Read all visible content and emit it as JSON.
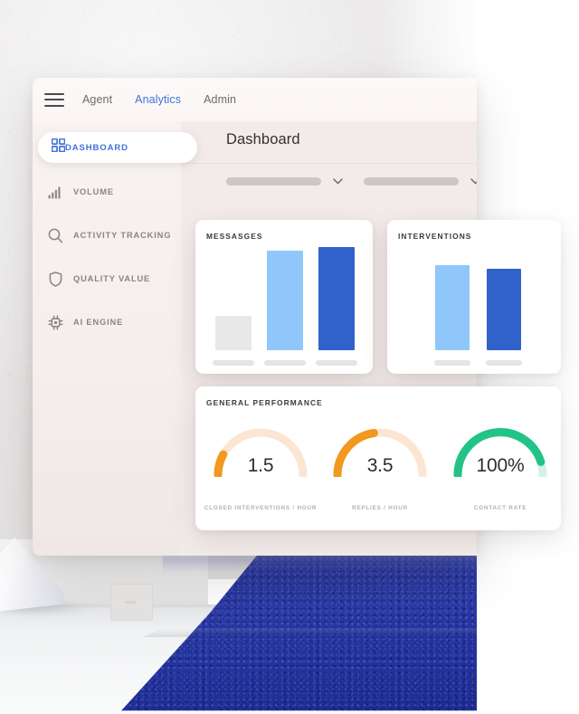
{
  "app": {
    "topbar": {
      "menu_icon": "hamburger-icon",
      "nav": [
        {
          "label": "Agent",
          "active": false
        },
        {
          "label": "Analytics",
          "active": true
        },
        {
          "label": "Admin",
          "active": false
        }
      ]
    },
    "sidebar": {
      "items": [
        {
          "label": "DASHBOARD",
          "icon": "grid-icon",
          "active": true
        },
        {
          "label": "VOLUME",
          "icon": "bar-chart-icon",
          "active": false
        },
        {
          "label": "ACTIVITY TRACKING",
          "icon": "search-icon",
          "active": false
        },
        {
          "label": "QUALITY VALUE",
          "icon": "shield-icon",
          "active": false
        },
        {
          "label": "AI ENGINE",
          "icon": "chip-icon",
          "active": false
        }
      ]
    },
    "main": {
      "page_title": "Dashboard",
      "filters": [
        {
          "name": "filter-one",
          "value": "",
          "icon": "chevron-down-icon"
        },
        {
          "name": "filter-two",
          "value": "",
          "icon": "chevron-down-icon"
        }
      ]
    }
  },
  "cards": {
    "messages": {
      "title": "MESSASGES"
    },
    "interventions": {
      "title": "INTERVENTIONS"
    },
    "performance": {
      "title": "GENERAL PERFORMANCE"
    }
  },
  "colors": {
    "accent_blue": "#4272d8",
    "bar_light_blue": "#8fc7fa",
    "bar_dark_blue": "#3162cb",
    "bar_grey": "#e8e8e9",
    "gauge_orange": "#f0981f",
    "gauge_orange_track": "#fbe6d3",
    "gauge_green": "#22c387",
    "gauge_green_track": "#d5f2e6",
    "window_bg": "#f2ebe9",
    "carpet_blue": "#243aa4"
  },
  "chart_data": [
    {
      "type": "bar",
      "title": "MESSASGES",
      "categories": [
        "",
        "",
        ""
      ],
      "values": [
        30,
        90,
        93
      ],
      "colors": [
        "#e8e8e9",
        "#8fc7fa",
        "#3162cb"
      ],
      "xlabel": "",
      "ylabel": "",
      "ylim": [
        0,
        100
      ],
      "grid": false,
      "legend": false
    },
    {
      "type": "bar",
      "title": "INTERVENTIONS",
      "categories": [
        "",
        ""
      ],
      "values": [
        78,
        75
      ],
      "colors": [
        "#8fc7fa",
        "#3162cb"
      ],
      "xlabel": "",
      "ylabel": "",
      "ylim": [
        0,
        100
      ],
      "grid": false,
      "legend": false
    },
    {
      "type": "gauge",
      "title": "GENERAL PERFORMANCE",
      "gauges": [
        {
          "label": "CLOSED INTERVENTIONS / HOUR",
          "display": "1.5",
          "value": 1.5,
          "percent": 18,
          "color": "#f0981f",
          "track": "#fbe6d3"
        },
        {
          "label": "REPLIES / HOUR",
          "display": "3.5",
          "value": 3.5,
          "percent": 45,
          "color": "#f0981f",
          "track": "#fbe6d3"
        },
        {
          "label": "CONTACT RATE",
          "display": "100%",
          "value": 100,
          "percent": 88,
          "color": "#22c387",
          "track": "#d5f2e6"
        }
      ]
    }
  ]
}
